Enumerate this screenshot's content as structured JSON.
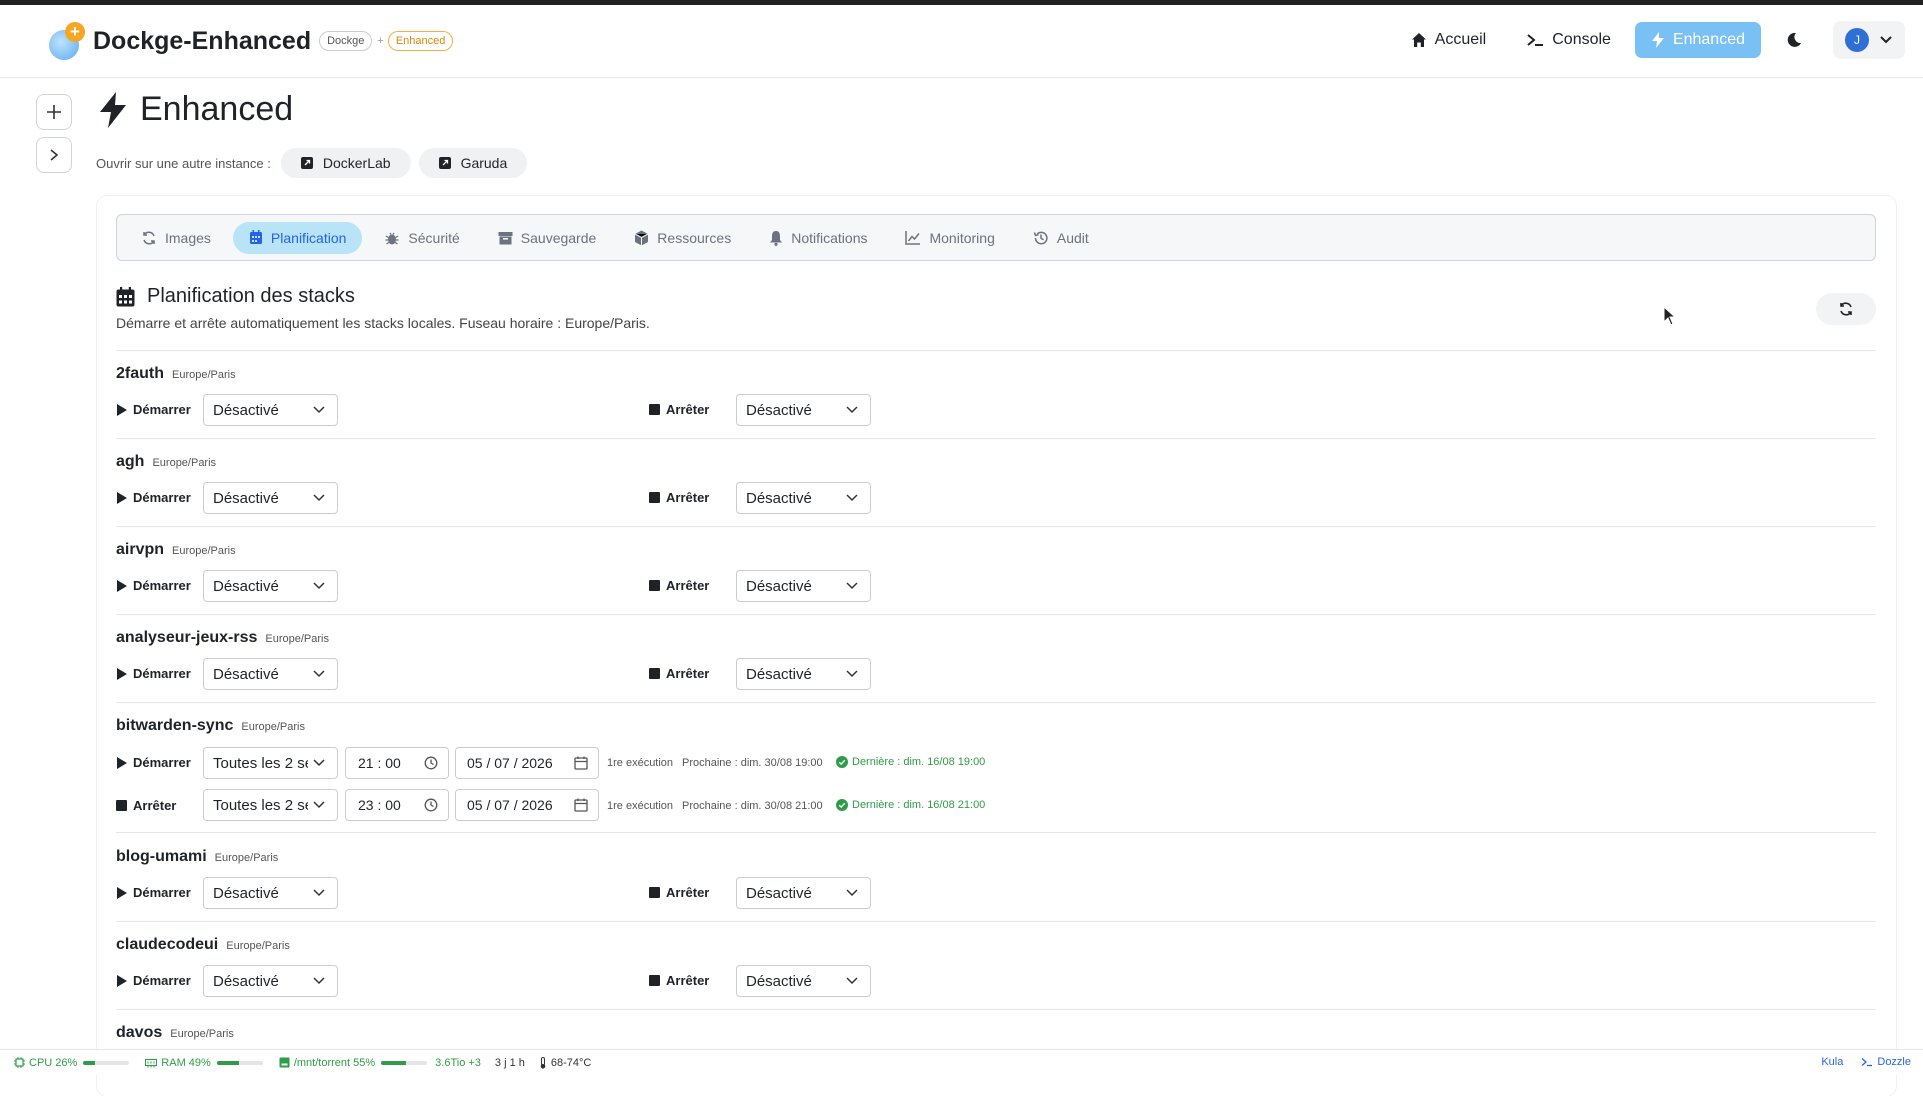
{
  "header": {
    "app_title": "Dockge-Enhanced",
    "badge_dockge": "Dockge",
    "badge_plus": "+",
    "badge_enhanced": "Enhanced",
    "nav": {
      "home": "Accueil",
      "console": "Console",
      "enhanced": "Enhanced"
    },
    "user_initial": "J"
  },
  "page": {
    "title": "Enhanced",
    "instances_label": "Ouvrir sur une autre instance :",
    "instances": [
      "DockerLab",
      "Garuda"
    ]
  },
  "tabs": [
    "Images",
    "Planification",
    "Sécurité",
    "Sauvegarde",
    "Ressources",
    "Notifications",
    "Monitoring",
    "Audit"
  ],
  "active_tab": "Planification",
  "section": {
    "title": "Planification des stacks",
    "description": "Démarre et arrête automatiquement les stacks locales. Fuseau horaire : Europe/Paris."
  },
  "labels": {
    "start": "Démarrer",
    "stop": "Arrêter",
    "disabled": "Désactivé"
  },
  "stacks": [
    {
      "name": "2fauth",
      "tz": "Europe/Paris",
      "start": "Désactivé",
      "stop": "Désactivé"
    },
    {
      "name": "agh",
      "tz": "Europe/Paris",
      "start": "Désactivé",
      "stop": "Désactivé"
    },
    {
      "name": "airvpn",
      "tz": "Europe/Paris",
      "start": "Désactivé",
      "stop": "Désactivé"
    },
    {
      "name": "analyseur-jeux-rss",
      "tz": "Europe/Paris",
      "start": "Désactivé",
      "stop": "Désactivé"
    },
    {
      "name": "bitwarden-sync",
      "tz": "Europe/Paris",
      "start": {
        "freq": "Toutes les 2 se",
        "time_h": "21",
        "time_m": "00",
        "date": "05 / 07 / 2026",
        "first": "1re exécution",
        "next": "Prochaine : dim. 30/08 19:00",
        "last": "Dernière : dim. 16/08 19:00"
      },
      "stop": {
        "freq": "Toutes les 2 se",
        "time_h": "23",
        "time_m": "00",
        "date": "05 / 07 / 2026",
        "first": "1re exécution",
        "next": "Prochaine : dim. 30/08 21:00",
        "last": "Dernière : dim. 16/08 21:00"
      }
    },
    {
      "name": "blog-umami",
      "tz": "Europe/Paris",
      "start": "Désactivé",
      "stop": "Désactivé"
    },
    {
      "name": "claudecodeui",
      "tz": "Europe/Paris",
      "start": "Désactivé",
      "stop": "Désactivé"
    },
    {
      "name": "davos",
      "tz": "Europe/Paris"
    }
  ],
  "footer": {
    "cpu": "CPU 26%",
    "cpu_pct": 26,
    "ram": "RAM 49%",
    "ram_pct": 49,
    "disk": "/mnt/torrent 55%",
    "disk_pct": 55,
    "disk_size": "3.6Tio +3",
    "uptime": "3 j 1 h",
    "temp": "68-74°C",
    "links": [
      "Kula",
      "Dozzle"
    ]
  }
}
